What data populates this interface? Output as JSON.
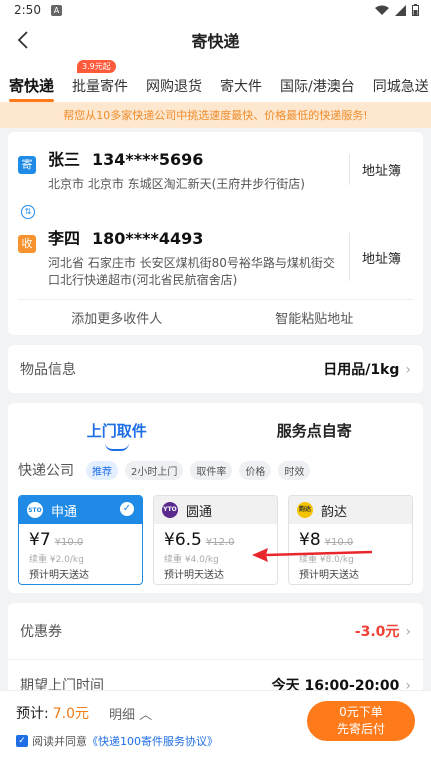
{
  "status": {
    "time": "2:50",
    "notif": "A"
  },
  "header": {
    "title": "寄快递"
  },
  "tabs": [
    {
      "label": "寄快递"
    },
    {
      "label": "批量寄件",
      "badge": "3.9元起"
    },
    {
      "label": "网购退货"
    },
    {
      "label": "寄大件"
    },
    {
      "label": "国际/港澳台"
    },
    {
      "label": "同城急送"
    }
  ],
  "promo": "帮您从10多家快递公司中挑选速度最快、价格最低的快递服务!",
  "sender": {
    "tag": "寄",
    "name": "张三",
    "phone": "134****5696",
    "address": "北京市 北京市 东城区淘汇新天(王府井步行街店)",
    "book": "地址簿"
  },
  "receiver": {
    "tag": "收",
    "name": "李四",
    "phone": "180****4493",
    "address": "河北省 石家庄市 长安区煤机街80号裕华路与煤机街交口北行快递超市(河北省民航宿舍店)",
    "book": "地址簿"
  },
  "addr_actions": {
    "add": "添加更多收件人",
    "paste": "智能粘贴地址"
  },
  "goods": {
    "label": "物品信息",
    "value": "日用品/1kg"
  },
  "service_tabs": {
    "pickup": "上门取件",
    "dropoff": "服务点自寄"
  },
  "filter": {
    "label": "快递公司",
    "chips": [
      "推荐",
      "2小时上门",
      "取件率",
      "价格",
      "时效"
    ]
  },
  "couriers": [
    {
      "name": "申通",
      "logo": "STO",
      "price": "¥7",
      "orig": "¥10.0",
      "sub": "续重 ¥2.0/kg",
      "eta": "预计明天送达"
    },
    {
      "name": "圆通",
      "logo": "YTO",
      "price": "¥6.5",
      "orig": "¥12.0",
      "sub": "续重 ¥4.0/kg",
      "eta": "预计明天送达"
    },
    {
      "name": "韵达",
      "logo": "韵达",
      "price": "¥8",
      "orig": "¥10.0",
      "sub": "续重 ¥8.0/kg",
      "eta": "预计明天送达"
    }
  ],
  "coupon": {
    "label": "优惠券",
    "value": "-3.0元"
  },
  "time": {
    "label": "期望上门时间",
    "value": "今天 16:00-20:00"
  },
  "footer": {
    "est_label": "预计:",
    "est_price": "7.0元",
    "detail": "明细 ︿",
    "agree_prefix": "阅读并同意",
    "agree_link": "《快递100寄件服务协议》",
    "submit_line1": "0元下单",
    "submit_line2": "先寄后付"
  },
  "colors": {
    "accent": "#ff7a1a",
    "blue": "#1f8be6",
    "red": "#f04136"
  }
}
